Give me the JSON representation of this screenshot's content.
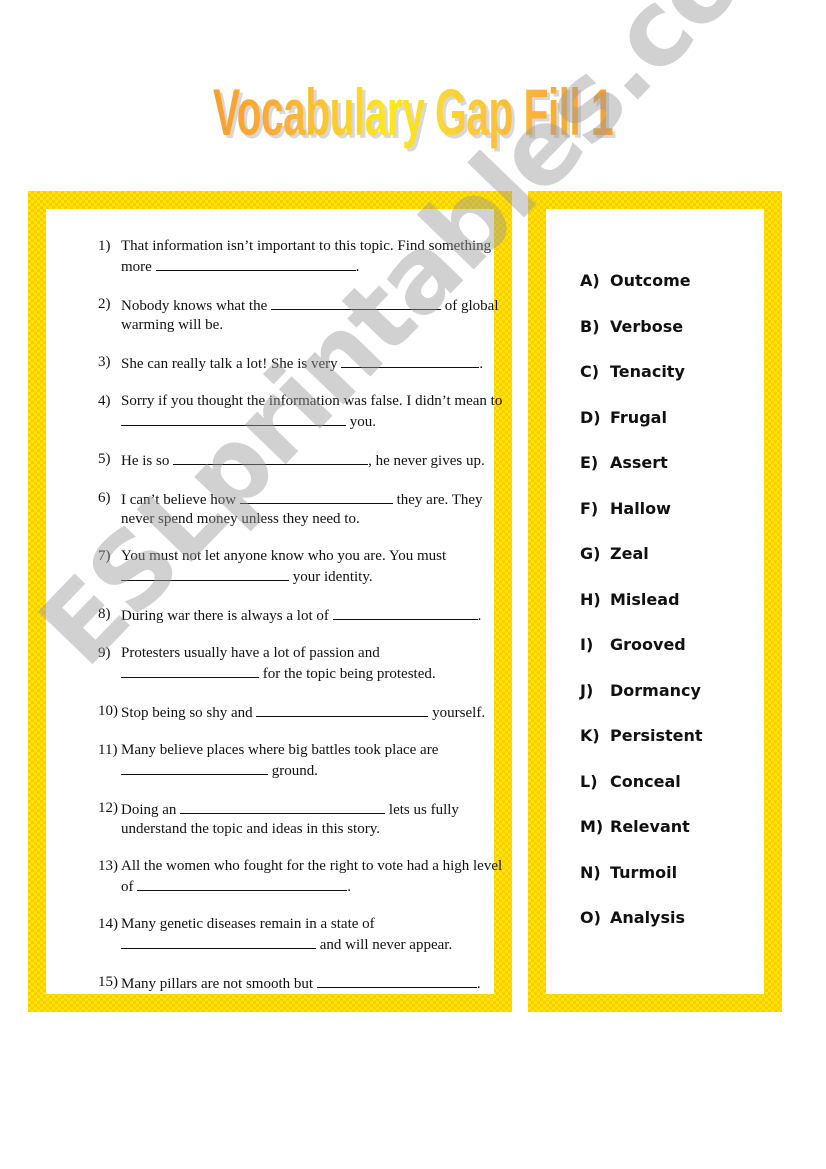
{
  "title": "Vocabulary Gap Fill 1",
  "questions": [
    {
      "num": "1)",
      "parts": [
        "That information isn’t important to this topic. Find something more ",
        "."
      ],
      "blanks": [
        200
      ]
    },
    {
      "num": "2)",
      "parts": [
        "Nobody knows what the ",
        " of global warming will be."
      ],
      "blanks": [
        170
      ]
    },
    {
      "num": "3)",
      "parts": [
        "She can really talk a lot! She is very ",
        "."
      ],
      "blanks": [
        138
      ]
    },
    {
      "num": "4)",
      "parts": [
        "Sorry if you thought the information was false. I didn’t mean to ",
        " you."
      ],
      "blanks": [
        225
      ]
    },
    {
      "num": "5)",
      "parts": [
        "He is so ",
        ", he never gives up."
      ],
      "blanks": [
        195
      ]
    },
    {
      "num": "6)",
      "parts": [
        "I can’t believe how ",
        " they are. They never spend money unless they need to."
      ],
      "blanks": [
        153
      ]
    },
    {
      "num": "7)",
      "parts": [
        "You must not let anyone know who you are.  You must ",
        " your identity."
      ],
      "blanks": [
        168
      ]
    },
    {
      "num": "8)",
      "parts": [
        "During war there is always a lot of ",
        "."
      ],
      "blanks": [
        145
      ]
    },
    {
      "num": "9)",
      "parts": [
        "Protesters usually have a lot of passion and ",
        " for the topic being protested."
      ],
      "blanks": [
        138
      ]
    },
    {
      "num": "10)",
      "parts": [
        "Stop being so shy and ",
        " yourself."
      ],
      "blanks": [
        172
      ]
    },
    {
      "num": "11)",
      "parts": [
        "Many believe places where big battles took place are ",
        " ground."
      ],
      "blanks": [
        147
      ]
    },
    {
      "num": "12)",
      "parts": [
        "Doing an ",
        " lets us fully understand the topic and ideas in this story."
      ],
      "blanks": [
        205
      ]
    },
    {
      "num": "13)",
      "parts": [
        "All the women who fought for the right to vote had a high level of ",
        "."
      ],
      "blanks": [
        210
      ]
    },
    {
      "num": "14)",
      "parts": [
        "Many genetic diseases remain in a state of ",
        " and will never appear."
      ],
      "blanks": [
        195
      ]
    },
    {
      "num": "15)",
      "parts": [
        "Many pillars are not smooth but ",
        "."
      ],
      "blanks": [
        160
      ]
    }
  ],
  "answers": [
    {
      "letter": "A)",
      "word": "Outcome"
    },
    {
      "letter": "B)",
      "word": "Verbose"
    },
    {
      "letter": "C)",
      "word": "Tenacity"
    },
    {
      "letter": "D)",
      "word": "Frugal"
    },
    {
      "letter": "E)",
      "word": "Assert"
    },
    {
      "letter": "F)",
      "word": "Hallow"
    },
    {
      "letter": "G)",
      "word": "Zeal"
    },
    {
      "letter": "H)",
      "word": "Mislead"
    },
    {
      "letter": "I)",
      "word": "Grooved"
    },
    {
      "letter": "J)",
      "word": "Dormancy"
    },
    {
      "letter": "K)",
      "word": "Persistent"
    },
    {
      "letter": "L)",
      "word": "Conceal"
    },
    {
      "letter": "M)",
      "word": "Relevant"
    },
    {
      "letter": "N)",
      "word": "Turmoil"
    },
    {
      "letter": "O)",
      "word": "Analysis"
    }
  ],
  "watermark": "ESLprintables.com",
  "colors": {
    "title_orange": "#f7941d",
    "title_yellow": "#ffe81a",
    "frame_yellow": "#ffe600",
    "frame_gold": "#ffcc00"
  }
}
